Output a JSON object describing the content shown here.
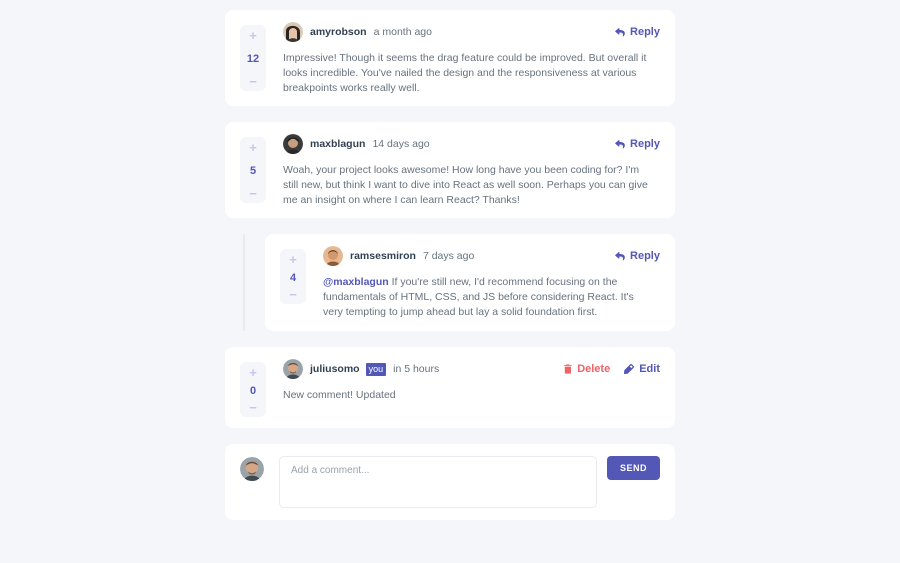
{
  "colors": {
    "accent": "#5357b6",
    "accent_light": "#c5c6ef",
    "danger": "#ed6368",
    "page_bg": "#f5f6fa",
    "card_bg": "#ffffff",
    "heading": "#324152",
    "body_text": "#67727e"
  },
  "comments": [
    {
      "username": "amyrobson",
      "time": "a month ago",
      "score": "12",
      "content": "Impressive! Though it seems the drag feature could be improved. But overall it looks incredible. You've nailed the design and the responsiveness at various breakpoints works really well.",
      "reply_label": "Reply"
    },
    {
      "username": "maxblagun",
      "time": "14 days ago",
      "score": "5",
      "content": "Woah, your project looks awesome! How long have you been coding for? I'm still new, but think I want to dive into React as well soon. Perhaps you can give me an insight on where I can learn React? Thanks!",
      "reply_label": "Reply",
      "replies": [
        {
          "username": "ramsesmiron",
          "time": "7 days ago",
          "score": "4",
          "mention": "@maxblagun",
          "content": " If you're still new, I'd recommend focusing on the fundamentals of HTML, CSS, and JS before considering React. It's very tempting to jump ahead but lay a solid foundation first.",
          "reply_label": "Reply"
        }
      ]
    },
    {
      "username": "juliusomo",
      "you_badge": "you",
      "time": "in 5 hours",
      "score": "0",
      "content": "New comment! Updated",
      "delete_label": "Delete",
      "edit_label": "Edit"
    }
  ],
  "vote": {
    "plus": "+",
    "minus": "−"
  },
  "composer": {
    "placeholder": "Add a comment...",
    "send_label": "SEND"
  },
  "icons": {
    "reply": "reply-arrow-icon",
    "delete": "trash-icon",
    "edit": "pencil-icon",
    "plus": "plus-icon",
    "minus": "minus-icon"
  }
}
